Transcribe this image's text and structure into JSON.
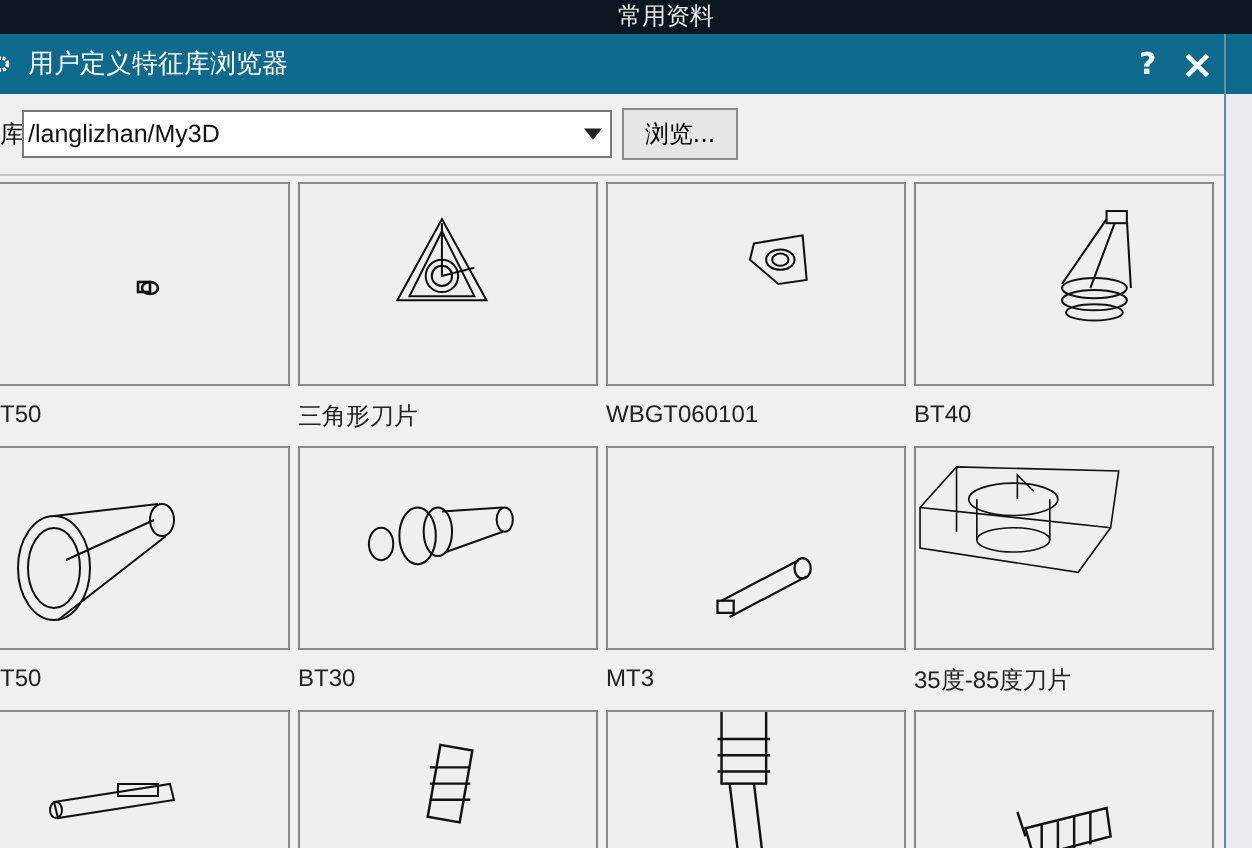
{
  "background": {
    "title": "常用资料"
  },
  "window": {
    "title": "用户定义特征库浏览器",
    "help": "?",
    "close": "×"
  },
  "library": {
    "label": "库",
    "value": "/langlizhan/My3D",
    "browse": "浏览..."
  },
  "items": [
    {
      "kind": "picture",
      "label": "T50"
    },
    {
      "kind": "picture",
      "label": "三角形刀片"
    },
    {
      "kind": "picture",
      "label": "WBGT060101"
    },
    {
      "kind": "picture",
      "label": "BT40"
    },
    {
      "kind": "picture",
      "label": "T50"
    },
    {
      "kind": "picture",
      "label": "BT30"
    },
    {
      "kind": "picture",
      "label": "MT3"
    },
    {
      "kind": "picture",
      "label": "35度-85度刀片"
    },
    {
      "kind": "picture"
    },
    {
      "kind": "picture"
    },
    {
      "kind": "picture"
    },
    {
      "kind": "picture"
    }
  ]
}
